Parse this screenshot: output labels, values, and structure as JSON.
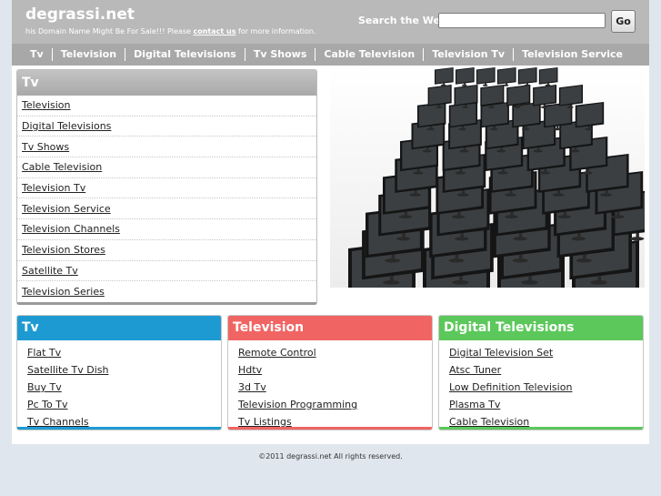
{
  "header": {
    "site_title": "degrassi.net",
    "sale_text_pre": "his Domain Name Might Be For Sale!!! Please ",
    "sale_link": "contact us",
    "sale_text_post": " for more information.",
    "search_label": "Search the Web:",
    "search_value": "",
    "search_button": "Go"
  },
  "topnav": {
    "items": [
      "Tv",
      "Television",
      "Digital Televisions",
      "Tv Shows",
      "Cable Television",
      "Television Tv",
      "Television Service"
    ]
  },
  "sidebar": {
    "title": "Tv",
    "items": [
      "Television",
      "Digital Televisions",
      "Tv Shows",
      "Cable Television",
      "Television Tv",
      "Television Service",
      "Television Channels",
      "Television Stores",
      "Satellite Tv",
      "Television Series"
    ]
  },
  "boxes": [
    {
      "title": "Tv",
      "color": "#1e9ad3",
      "links": [
        "Flat Tv",
        "Satellite Tv Dish",
        "Buy Tv",
        "Pc To Tv",
        "Tv Channels"
      ]
    },
    {
      "title": "Television",
      "color": "#f06563",
      "links": [
        "Remote Control",
        "Hdtv",
        "3d Tv",
        "Television Programming",
        "Tv Listings"
      ]
    },
    {
      "title": "Digital Televisions",
      "color": "#5cc85b",
      "links": [
        "Digital Television Set",
        "Atsc Tuner",
        "Low Definition Television",
        "Plasma Tv",
        "Cable Television"
      ]
    }
  ],
  "footer": {
    "text": "©2011 degrassi.net All rights reserved."
  }
}
